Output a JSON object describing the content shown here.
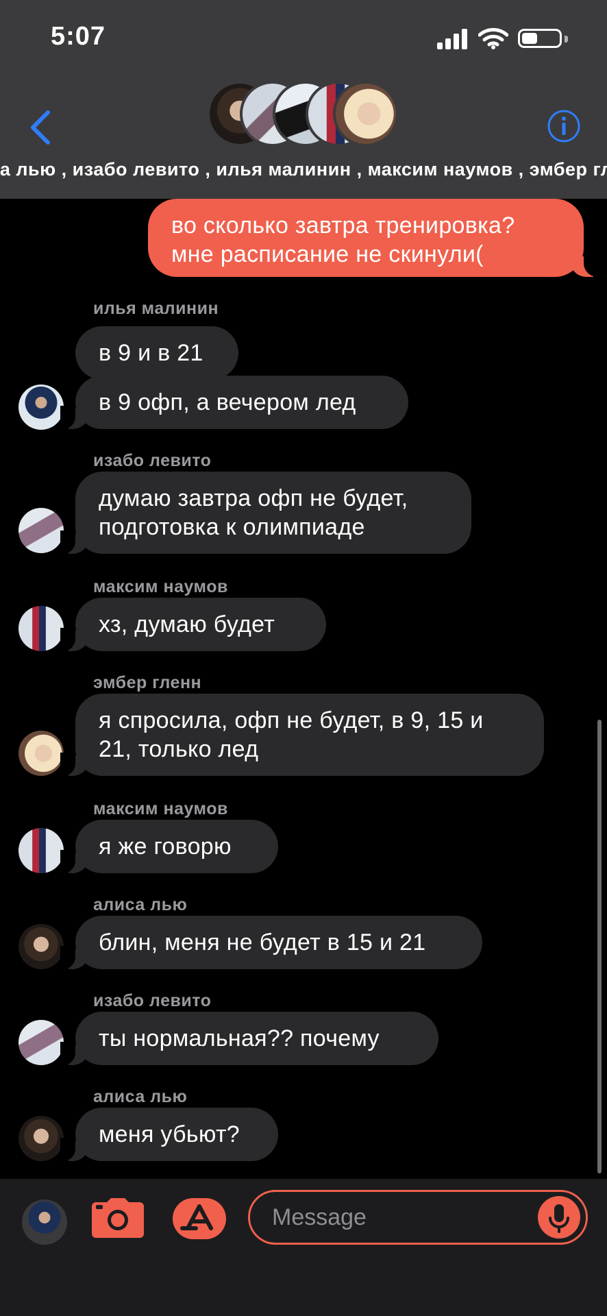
{
  "status_bar": {
    "time": "5:07"
  },
  "header": {
    "members_line": "са лью , изабо левито , илья малинин , максим наумов , эмбер гл"
  },
  "messages": [
    {
      "direction": "outgoing",
      "text": "во сколько завтра тренировка? мне расписание не скинули("
    },
    {
      "direction": "incoming",
      "sender": "илья малинин",
      "texts": [
        "в 9 и в 21",
        "в 9 офп, а вечером лед"
      ]
    },
    {
      "direction": "incoming",
      "sender": "изабо левито",
      "texts": [
        "думаю завтра офп не будет, подготовка к олимпиаде"
      ]
    },
    {
      "direction": "incoming",
      "sender": "максим наумов",
      "texts": [
        "хз, думаю будет"
      ]
    },
    {
      "direction": "incoming",
      "sender": "эмбер гленн",
      "texts": [
        "я спросила, офп не будет, в 9, 15 и 21, только лед"
      ]
    },
    {
      "direction": "incoming",
      "sender": "максим наумов",
      "texts": [
        "я же говорю"
      ]
    },
    {
      "direction": "incoming",
      "sender": "алиса лью",
      "texts": [
        "блин, меня не будет в 15 и 21"
      ]
    },
    {
      "direction": "incoming",
      "sender": "изабо левито",
      "texts": [
        "ты нормальная?? почему"
      ]
    },
    {
      "direction": "incoming",
      "sender": "алиса лью",
      "texts": [
        "меня убьют?"
      ]
    }
  ],
  "input": {
    "placeholder": "Message"
  },
  "icons": {
    "back": "chevron-left-icon",
    "info": "info-icon",
    "camera": "camera-icon",
    "app_store": "app-store-icon",
    "mic": "microphone-icon"
  },
  "colors": {
    "accent": "#f0604d",
    "incoming_bubble": "#2a2a2c",
    "header_bg": "#3b3b3d",
    "link_blue": "#2f7cf6",
    "sender_gray": "#9a9a9e"
  }
}
